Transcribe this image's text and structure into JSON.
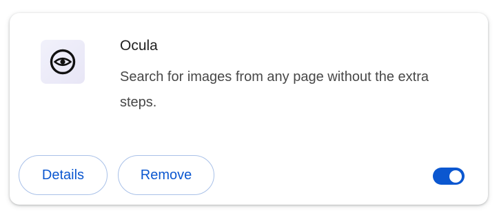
{
  "extension": {
    "name": "Ocula",
    "description": "Search for images from any page without the extra steps.",
    "icon": "eye-icon"
  },
  "actions": {
    "details_label": "Details",
    "remove_label": "Remove"
  },
  "toggle": {
    "enabled": true,
    "color": "#0b57d0"
  },
  "colors": {
    "accent": "#0b57d0",
    "button_border": "#a8c0e8",
    "title_text": "#1f1f1f",
    "body_text": "#474747"
  }
}
